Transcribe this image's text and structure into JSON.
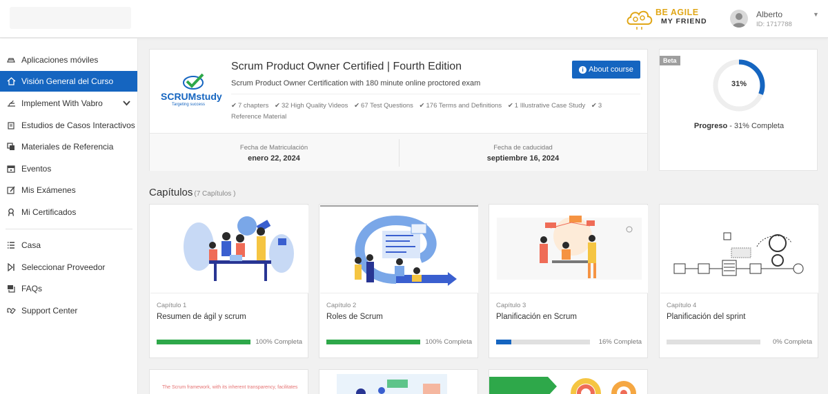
{
  "header": {
    "brand_line1": "BE AGILE",
    "brand_line2": "MY FRIEND",
    "user_name": "Alberto",
    "user_id": "ID: 1717788"
  },
  "sidebar": {
    "items": [
      {
        "label": "Aplicaciones móviles",
        "icon": "mobile-icon"
      },
      {
        "label": "Visión General del Curso",
        "icon": "home-icon",
        "active": true
      },
      {
        "label": "Implement With Vabro",
        "icon": "vabro-icon"
      },
      {
        "label": "Estudios de Casos Interactivos",
        "icon": "case-study-icon"
      },
      {
        "label": "Materiales de Referencia",
        "icon": "copy-icon"
      },
      {
        "label": "Eventos",
        "icon": "calendar-icon"
      },
      {
        "label": "Mis Exámenes",
        "icon": "edit-icon"
      },
      {
        "label": "Mi Certificados",
        "icon": "award-icon"
      },
      {
        "label": "Casa",
        "icon": "list-icon"
      },
      {
        "label": "Seleccionar Proveedor",
        "icon": "skip-icon"
      },
      {
        "label": "FAQs",
        "icon": "faq-icon"
      },
      {
        "label": "Support Center",
        "icon": "handshake-icon"
      }
    ]
  },
  "course": {
    "title": "Scrum Product Owner Certified | Fourth Edition",
    "subtitle": "Scrum Product Owner Certification with 180 minute online proctored exam",
    "about_label": "About course",
    "logo_text": "SCRUMstudy",
    "logo_tagline": "Targeting success",
    "features": [
      "7 chapters",
      "32 High Quality Videos",
      "67 Test Questions",
      "176 Terms and Definitions",
      "1 Illustrative Case Study",
      "3 Reference Material"
    ],
    "enroll_label": "Fecha de Matriculación",
    "enroll_date": "enero 22, 2024",
    "expiry_label": "Fecha de caducidad",
    "expiry_date": "septiembre 16, 2024"
  },
  "progress": {
    "beta_label": "Beta",
    "percent": 31,
    "percent_label": "31%",
    "label_bold": "Progreso",
    "label_rest": " - 31% Completa",
    "ring_color": "#1565c0"
  },
  "chapters": {
    "heading": "Capítulos",
    "count": "(7 Capítulos )",
    "items": [
      {
        "num": "Capítulo 1",
        "title": "Resumen de ágil y scrum",
        "progress": 100,
        "pct_label": "100% Completa",
        "color": "#2ea84a"
      },
      {
        "num": "Capítulo 2",
        "title": "Roles de Scrum",
        "progress": 100,
        "pct_label": "100% Completa",
        "color": "#2ea84a"
      },
      {
        "num": "Capítulo 3",
        "title": "Planificación en Scrum",
        "progress": 16,
        "pct_label": "16% Completa",
        "color": "#1565c0"
      },
      {
        "num": "Capítulo 4",
        "title": "Planificación del sprint",
        "progress": 0,
        "pct_label": "0% Completa",
        "color": "#1565c0"
      }
    ],
    "partial_caption": "The Scrum framework, with its inherent transparency, facilitates"
  }
}
